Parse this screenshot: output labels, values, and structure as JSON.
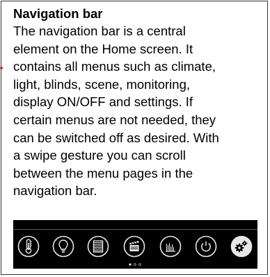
{
  "title": "Navigation bar",
  "lines": [
    "The navigation bar is a central",
    "element on the Home screen. It",
    "contains all menus such as climate,",
    "light, blinds, scene, monitoring,",
    "display ON/OFF and settings. If",
    "certain menus are not needed, they",
    "can be switched off as desired. With",
    "a swipe gesture you can scroll",
    "between the menu pages in the",
    "navigation bar."
  ],
  "navbar": {
    "icons": [
      "thermometer-icon",
      "lightbulb-icon",
      "blinds-icon",
      "scene-clapperboard-icon",
      "monitoring-chart-icon",
      "power-icon",
      "settings-gears-icon"
    ],
    "active_page": 1,
    "page_count": 3
  },
  "colors": {
    "navbar_bg": "#000000",
    "icon_stroke": "#e6e6e6",
    "frame_border": "#333333"
  }
}
